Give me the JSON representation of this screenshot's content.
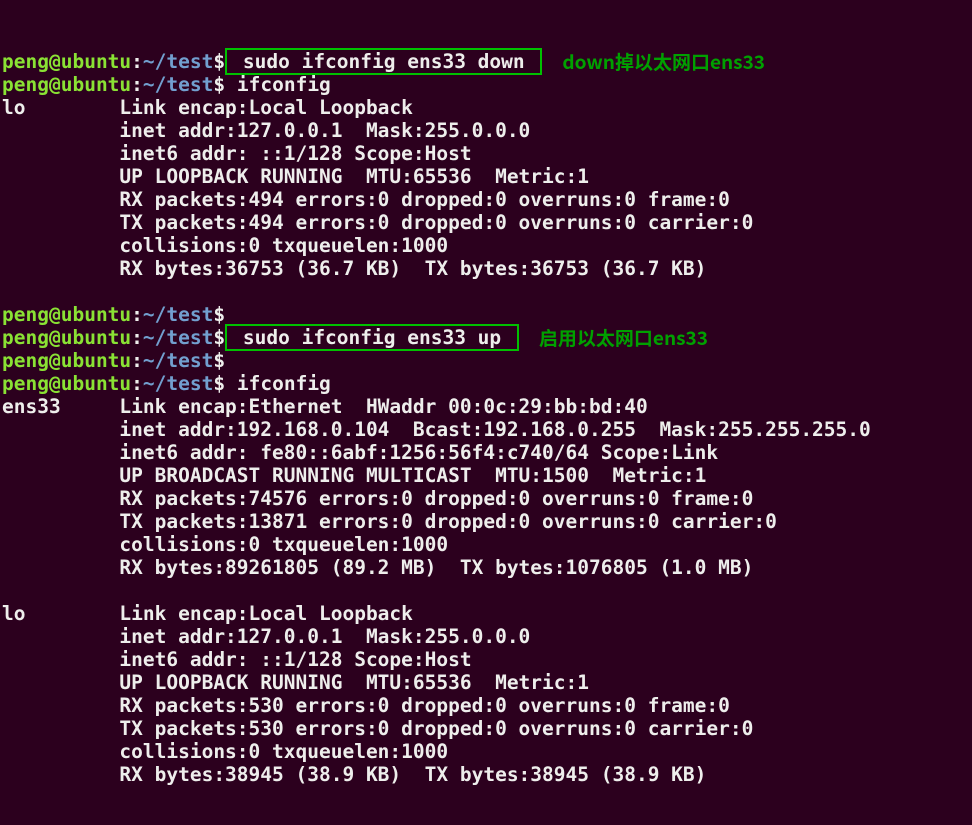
{
  "prompt": {
    "user": "peng",
    "at": "@",
    "host": "ubuntu",
    "colon": ":",
    "tilde": "~",
    "slash": "/",
    "dir": "test",
    "dollar": "$"
  },
  "cmd": {
    "down": " sudo ifconfig ens33 down ",
    "ifconfig1": " ifconfig",
    "up": " sudo ifconfig ens33 up ",
    "ifconfig2": " ifconfig"
  },
  "anno": {
    "down": "down掉以太网口ens33",
    "up": "启用以太网口ens33"
  },
  "out1": [
    "lo        Link encap:Local Loopback  ",
    "          inet addr:127.0.0.1  Mask:255.0.0.0",
    "          inet6 addr: ::1/128 Scope:Host",
    "          UP LOOPBACK RUNNING  MTU:65536  Metric:1",
    "          RX packets:494 errors:0 dropped:0 overruns:0 frame:0",
    "          TX packets:494 errors:0 dropped:0 overruns:0 carrier:0",
    "          collisions:0 txqueuelen:1000 ",
    "          RX bytes:36753 (36.7 KB)  TX bytes:36753 (36.7 KB)",
    ""
  ],
  "out2": [
    "ens33     Link encap:Ethernet  HWaddr 00:0c:29:bb:bd:40  ",
    "          inet addr:192.168.0.104  Bcast:192.168.0.255  Mask:255.255.255.0",
    "          inet6 addr: fe80::6abf:1256:56f4:c740/64 Scope:Link",
    "          UP BROADCAST RUNNING MULTICAST  MTU:1500  Metric:1",
    "          RX packets:74576 errors:0 dropped:0 overruns:0 frame:0",
    "          TX packets:13871 errors:0 dropped:0 overruns:0 carrier:0",
    "          collisions:0 txqueuelen:1000 ",
    "          RX bytes:89261805 (89.2 MB)  TX bytes:1076805 (1.0 MB)",
    "",
    "lo        Link encap:Local Loopback  ",
    "          inet addr:127.0.0.1  Mask:255.0.0.0",
    "          inet6 addr: ::1/128 Scope:Host",
    "          UP LOOPBACK RUNNING  MTU:65536  Metric:1",
    "          RX packets:530 errors:0 dropped:0 overruns:0 frame:0",
    "          TX packets:530 errors:0 dropped:0 overruns:0 carrier:0",
    "          collisions:0 txqueuelen:1000 ",
    "          RX bytes:38945 (38.9 KB)  TX bytes:38945 (38.9 KB)",
    ""
  ]
}
